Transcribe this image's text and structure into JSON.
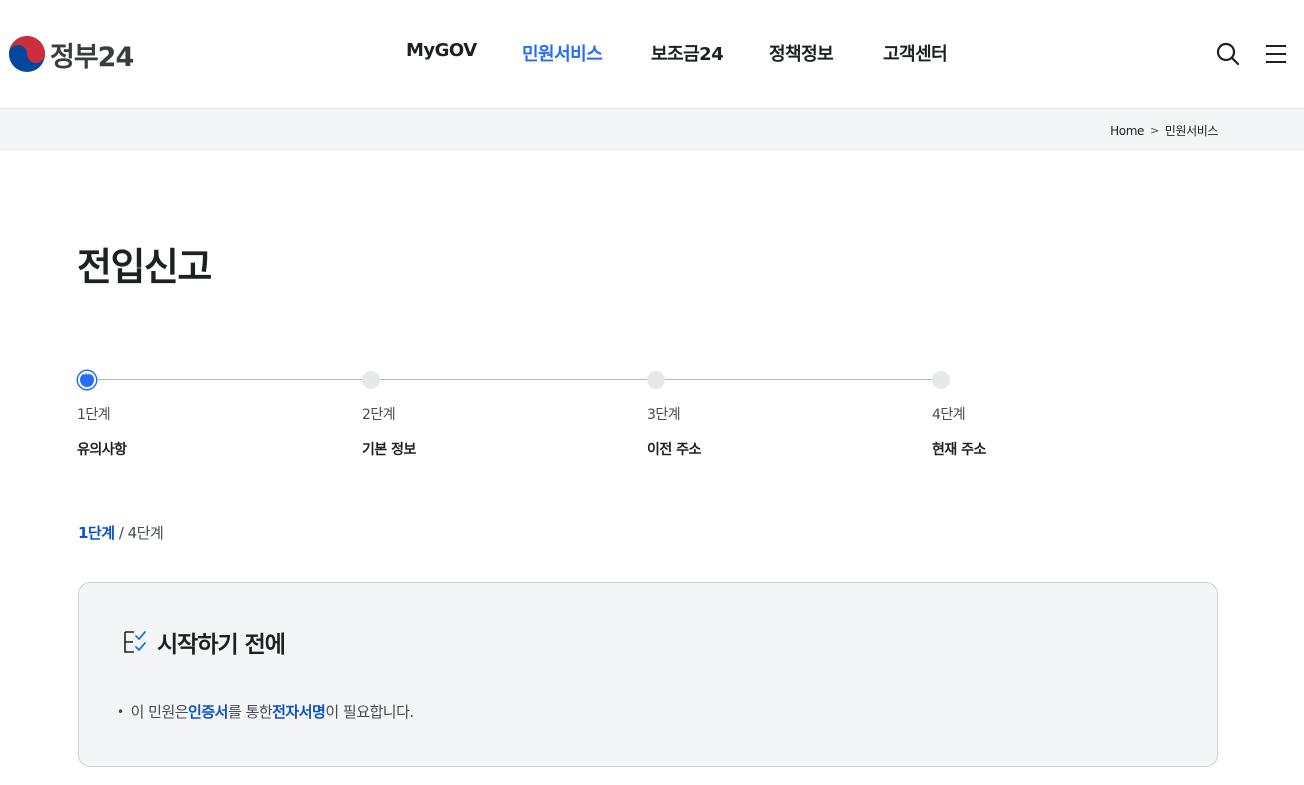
{
  "header": {
    "logo_text": "정부24",
    "nav": [
      "MyGOV",
      "민원서비스",
      "보조금24",
      "정책정보",
      "고객센터"
    ],
    "active_nav": "민원서비스",
    "icons": [
      "search-icon",
      "menu-icon"
    ]
  },
  "breadcrumb": {
    "home": "Home",
    "current": "민원서비스"
  },
  "page": {
    "title": "전입신고"
  },
  "stepper": {
    "steps": [
      {
        "num": "1단계",
        "name": "유의사항"
      },
      {
        "num": "2단계",
        "name": "기본 정보"
      },
      {
        "num": "3단계",
        "name": "이전 주소"
      },
      {
        "num": "4단계",
        "name": "현재 주소"
      }
    ],
    "current_step": 1
  },
  "counter": {
    "current": "1단계",
    "separator": " / ",
    "total": "4단계"
  },
  "notice": {
    "title": "시작하기 전에",
    "text_parts": [
      "이 민원은 ",
      "인증서",
      "를 통한 ",
      "전자서명",
      "이 필요합니다."
    ]
  },
  "colors": {
    "accent": "#256ef4",
    "highlight": "#0b50d0",
    "logo_red": "#cd2e3a",
    "logo_blue": "#0047a0"
  }
}
